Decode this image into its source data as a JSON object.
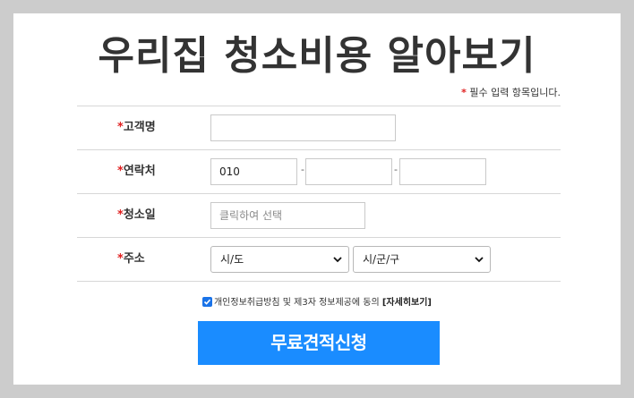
{
  "page": {
    "title": "우리집 청소비용 알아보기",
    "required_note": "필수 입력 항목입니다.",
    "required_mark": "*"
  },
  "form": {
    "name": {
      "label": "고객명",
      "value": ""
    },
    "phone": {
      "label": "연락처",
      "part1": "010",
      "part2": "",
      "part3": "",
      "separator": "-"
    },
    "date": {
      "label": "청소일",
      "placeholder": "클릭하여 선택"
    },
    "address": {
      "label": "주소",
      "city_selected": "시/도",
      "district_selected": "시/군/구"
    }
  },
  "consent": {
    "checked": true,
    "text": "개인정보취급방침 및 제3자 정보제공에 동의",
    "detail_link": "[자세히보기]"
  },
  "submit": {
    "label": "무료견적신청"
  },
  "colors": {
    "background": "#cccccc",
    "required": "#e02020",
    "button": "#1a8cff",
    "checkbox": "#1a73e8"
  }
}
